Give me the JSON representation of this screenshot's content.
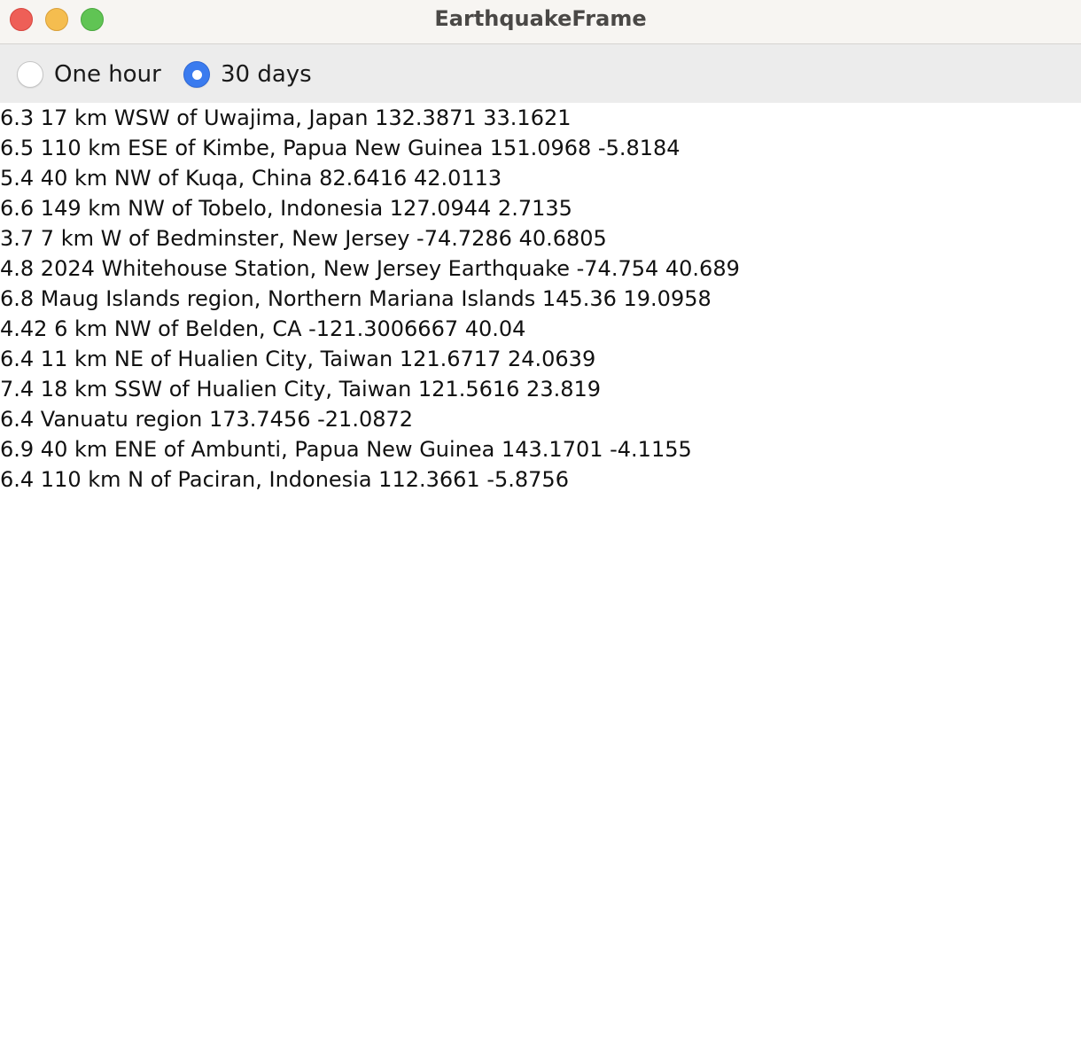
{
  "window": {
    "title": "EarthquakeFrame",
    "controls": [
      "close",
      "minimize",
      "maximize"
    ]
  },
  "toolbar": {
    "options": [
      {
        "label": "One hour",
        "selected": false
      },
      {
        "label": "30 days",
        "selected": true
      }
    ]
  },
  "earthquakes": [
    "6.3 17 km WSW of Uwajima, Japan 132.3871 33.1621",
    "6.5 110 km ESE of Kimbe, Papua New Guinea 151.0968 -5.8184",
    "5.4 40 km NW of Kuqa, China 82.6416 42.0113",
    "6.6 149 km NW of Tobelo, Indonesia 127.0944 2.7135",
    "3.7 7 km W of Bedminster, New Jersey -74.7286 40.6805",
    "4.8 2024 Whitehouse Station, New Jersey Earthquake -74.754 40.689",
    "6.8 Maug Islands region, Northern Mariana Islands 145.36 19.0958",
    "4.42 6 km NW of Belden, CA -121.3006667 40.04",
    "6.4 11 km NE of Hualien City, Taiwan 121.6717 24.0639",
    "7.4 18 km SSW of Hualien City, Taiwan 121.5616 23.819",
    "6.4 Vanuatu region 173.7456 -21.0872",
    "6.9 40 km ENE of Ambunti, Papua New Guinea 143.1701 -4.1155",
    "6.4 110 km N of Paciran, Indonesia 112.3661 -5.8756"
  ],
  "colors": {
    "close": "#ee5f57",
    "minimize": "#f5bd4f",
    "maximize": "#60c454",
    "radio_selected": "#3a7bef",
    "toolbar_bg": "#ececec",
    "titlebar_bg": "#f7f5f2"
  }
}
